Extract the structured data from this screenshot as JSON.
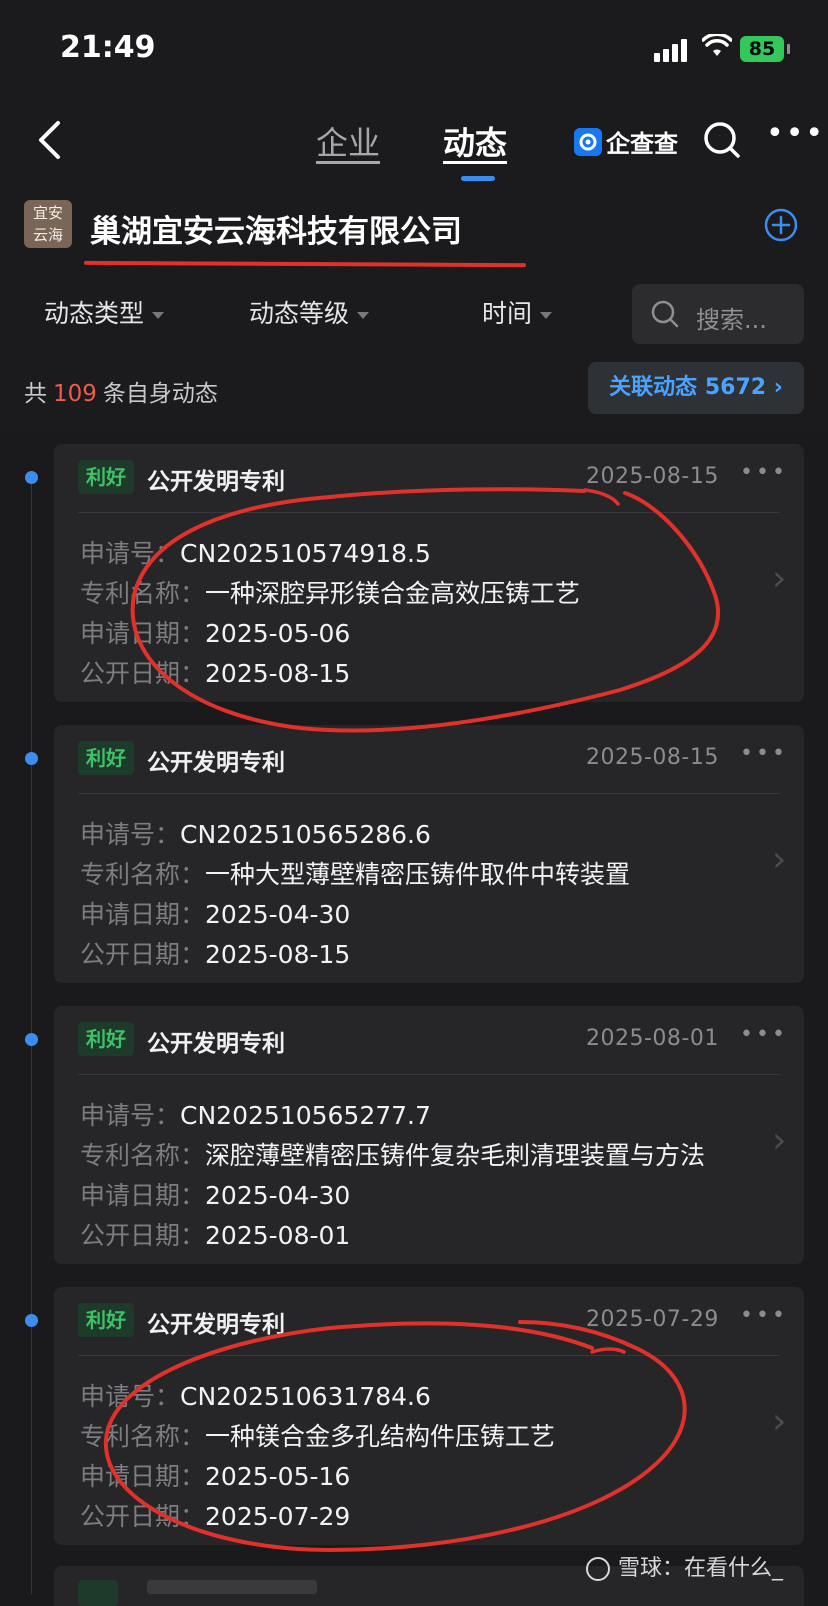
{
  "status_bar": {
    "time": "21:49",
    "battery": "85"
  },
  "nav": {
    "tab_enterprise": "企业",
    "tab_dynamics": "动态",
    "brand": "企查查"
  },
  "company": {
    "logo_text": "宜安\n云海",
    "name": "巢湖宜安云海科技有限公司"
  },
  "filters": {
    "type": "动态类型",
    "level": "动态等级",
    "time": "时间",
    "search_placeholder": "搜索..."
  },
  "summary": {
    "prefix": "共",
    "count": "109",
    "suffix": "条自身动态",
    "related_label": "关联动态",
    "related_count": "5672"
  },
  "field_labels": {
    "app_no": "申请号：",
    "patent_name": "专利名称：",
    "apply_date": "申请日期：",
    "publish_date": "公开日期："
  },
  "items": [
    {
      "tag": "利好",
      "type": "公开发明专利",
      "date": "2025-08-15",
      "app_no": "CN202510574918.5",
      "patent_name": "一种深腔异形镁合金高效压铸工艺",
      "apply_date": "2025-05-06",
      "publish_date": "2025-08-15"
    },
    {
      "tag": "利好",
      "type": "公开发明专利",
      "date": "2025-08-15",
      "app_no": "CN202510565286.6",
      "patent_name": "一种大型薄壁精密压铸件取件中转装置",
      "apply_date": "2025-04-30",
      "publish_date": "2025-08-15"
    },
    {
      "tag": "利好",
      "type": "公开发明专利",
      "date": "2025-08-01",
      "app_no": "CN202510565277.7",
      "patent_name": "深腔薄壁精密压铸件复杂毛刺清理装置与方法",
      "apply_date": "2025-04-30",
      "publish_date": "2025-08-01"
    },
    {
      "tag": "利好",
      "type": "公开发明专利",
      "date": "2025-07-29",
      "app_no": "CN202510631784.6",
      "patent_name": "一种镁合金多孔结构件压铸工艺",
      "apply_date": "2025-05-16",
      "publish_date": "2025-07-29"
    }
  ],
  "watermark": "雪球：在看什么_",
  "colors": {
    "accent": "#3a8ef0",
    "positive": "#3fc267",
    "count_red": "#ef5a4c",
    "annotation_red": "#e0312b"
  }
}
